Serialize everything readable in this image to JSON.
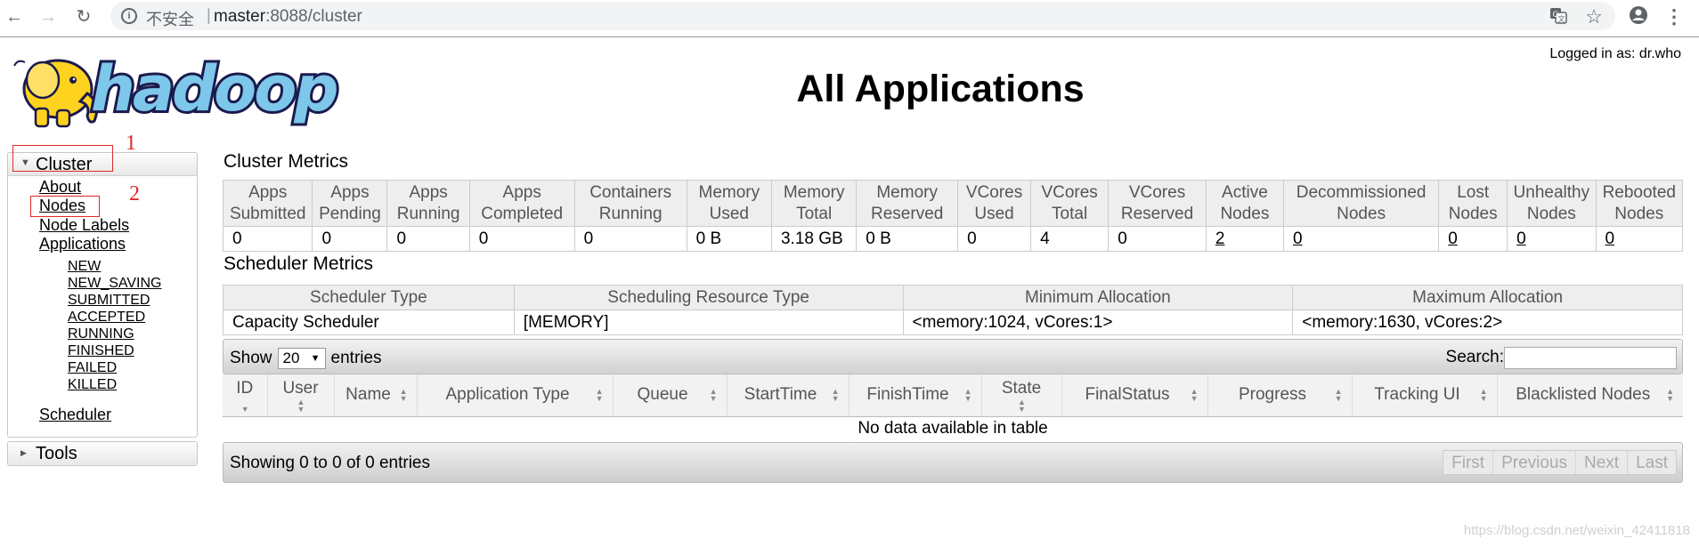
{
  "browser": {
    "insecure_label": "不安全",
    "url_host": "master",
    "url_rest": ":8088/cluster"
  },
  "header": {
    "logo_text": "hadoop",
    "title": "All Applications",
    "logged_in": "Logged in as: dr.who"
  },
  "sidebar": {
    "cluster": {
      "label": "Cluster",
      "items": [
        {
          "label": "About"
        },
        {
          "label": "Nodes"
        },
        {
          "label": "Node Labels"
        },
        {
          "label": "Applications"
        },
        {
          "label": "NEW"
        },
        {
          "label": "NEW_SAVING"
        },
        {
          "label": "SUBMITTED"
        },
        {
          "label": "ACCEPTED"
        },
        {
          "label": "RUNNING"
        },
        {
          "label": "FINISHED"
        },
        {
          "label": "FAILED"
        },
        {
          "label": "KILLED"
        },
        {
          "label": "Scheduler"
        }
      ]
    },
    "tools": {
      "label": "Tools"
    }
  },
  "annotations": {
    "one": "1",
    "two": "2"
  },
  "cluster_metrics": {
    "title": "Cluster Metrics",
    "headers": [
      [
        "Apps",
        "Submitted"
      ],
      [
        "Apps",
        "Pending"
      ],
      [
        "Apps",
        "Running"
      ],
      [
        "Apps",
        "Completed"
      ],
      [
        "Containers",
        "Running"
      ],
      [
        "Memory",
        "Used"
      ],
      [
        "Memory",
        "Total"
      ],
      [
        "Memory",
        "Reserved"
      ],
      [
        "VCores",
        "Used"
      ],
      [
        "VCores",
        "Total"
      ],
      [
        "VCores",
        "Reserved"
      ],
      [
        "Active",
        "Nodes"
      ],
      [
        "Decommissioned",
        "Nodes"
      ],
      [
        "Lost",
        "Nodes"
      ],
      [
        "Unhealthy",
        "Nodes"
      ],
      [
        "Rebooted",
        "Nodes"
      ]
    ],
    "values": [
      "0",
      "0",
      "0",
      "0",
      "0",
      "0 B",
      "3.18 GB",
      "0 B",
      "0",
      "4",
      "0",
      "2",
      "0",
      "0",
      "0",
      "0"
    ]
  },
  "scheduler_metrics": {
    "title": "Scheduler Metrics",
    "headers": [
      "Scheduler Type",
      "Scheduling Resource Type",
      "Minimum Allocation",
      "Maximum Allocation"
    ],
    "values": [
      "Capacity Scheduler",
      "[MEMORY]",
      "<memory:1024, vCores:1>",
      "<memory:1630, vCores:2>"
    ]
  },
  "apps_table": {
    "show_label": "Show",
    "page_length": "20",
    "entries_label": "entries",
    "search_label": "Search:",
    "columns": [
      {
        "label": "ID"
      },
      {
        "label": "User"
      },
      {
        "label": "Name"
      },
      {
        "label": "Application Type"
      },
      {
        "label": "Queue"
      },
      {
        "label": "StartTime"
      },
      {
        "label": "FinishTime"
      },
      {
        "label": "State"
      },
      {
        "label": "FinalStatus"
      },
      {
        "label": "Progress"
      },
      {
        "label": "Tracking UI"
      },
      {
        "label": "Blacklisted Nodes"
      }
    ],
    "empty_message": "No data available in table",
    "info": "Showing 0 to 0 of 0 entries",
    "pager": {
      "first": "First",
      "previous": "Previous",
      "next": "Next",
      "last": "Last"
    }
  },
  "watermark": "https://blog.csdn.net/weixin_42411818",
  "colors": {
    "annotation": "#e0282a",
    "logo_blue": "#1a1a4d",
    "logo_yellow": "#ffd21f"
  }
}
